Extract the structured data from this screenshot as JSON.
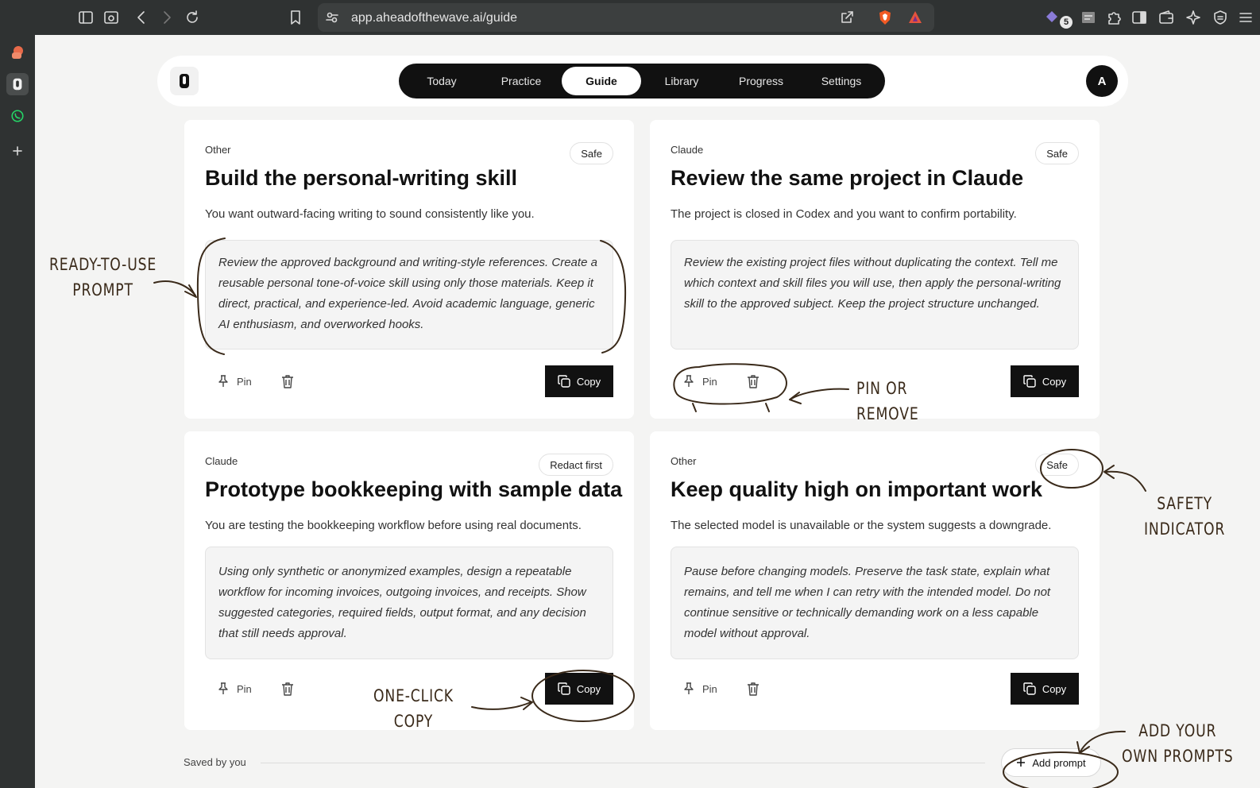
{
  "browser": {
    "url": "app.aheadofthewave.ai/guide",
    "extensions_badge": "5"
  },
  "nav": {
    "tabs": [
      {
        "label": "Today"
      },
      {
        "label": "Practice"
      },
      {
        "label": "Guide",
        "active": true
      },
      {
        "label": "Library"
      },
      {
        "label": "Progress"
      },
      {
        "label": "Settings"
      }
    ],
    "avatar": "A"
  },
  "cards": [
    {
      "category": "Other",
      "badge": "Safe",
      "title": "Build the personal-writing skill",
      "description": "You want outward-facing writing to sound consistently like you.",
      "prompt": "Review the approved background and writing-style references. Create a reusable personal tone-of-voice skill using only those materials. Keep it direct, practical, and experience-led. Avoid academic language, generic AI enthusiasm, and overworked hooks.",
      "pin_label": "Pin",
      "copy_label": "Copy"
    },
    {
      "category": "Claude",
      "badge": "Safe",
      "title": "Review the same project in Claude",
      "description": "The project is closed in Codex and you want to confirm portability.",
      "prompt": "Review the existing project files without duplicating the context. Tell me which context and skill files you will use, then apply the personal-writing skill to the approved subject. Keep the project structure unchanged.",
      "pin_label": "Pin",
      "copy_label": "Copy"
    },
    {
      "category": "Claude",
      "badge": "Redact first",
      "title": "Prototype bookkeeping with sample data",
      "description": "You are testing the bookkeeping workflow before using real documents.",
      "prompt": "Using only synthetic or anonymized examples, design a repeatable workflow for incoming invoices, outgoing invoices, and receipts. Show suggested categories, required fields, output format, and any decision that still needs approval.",
      "pin_label": "Pin",
      "copy_label": "Copy"
    },
    {
      "category": "Other",
      "badge": "Safe",
      "title": "Keep quality high on important work",
      "description": "The selected model is unavailable or the system suggests a downgrade.",
      "prompt": "Pause before changing models. Preserve the task state, explain what remains, and tell me when I can retry with the intended model. Do not continue sensitive or technically demanding work on a less capable model without approval.",
      "pin_label": "Pin",
      "copy_label": "Copy"
    }
  ],
  "saved": {
    "label": "Saved by you",
    "add_button": "Add prompt"
  },
  "annotations": {
    "ready_prompt": [
      "READY-TO-USE",
      "PROMPT"
    ],
    "pin_remove": [
      "PIN OR",
      "REMOVE"
    ],
    "safety": [
      "SAFETY",
      "INDICATOR"
    ],
    "one_click": [
      "ONE-CLICK",
      "COPY"
    ],
    "add_own": [
      "ADD YOUR",
      "OWN PROMPTS"
    ]
  },
  "colors": {
    "annotation_ink": "#3a2a1a",
    "primary": "#111111",
    "page_background": "#f4f4f3"
  }
}
